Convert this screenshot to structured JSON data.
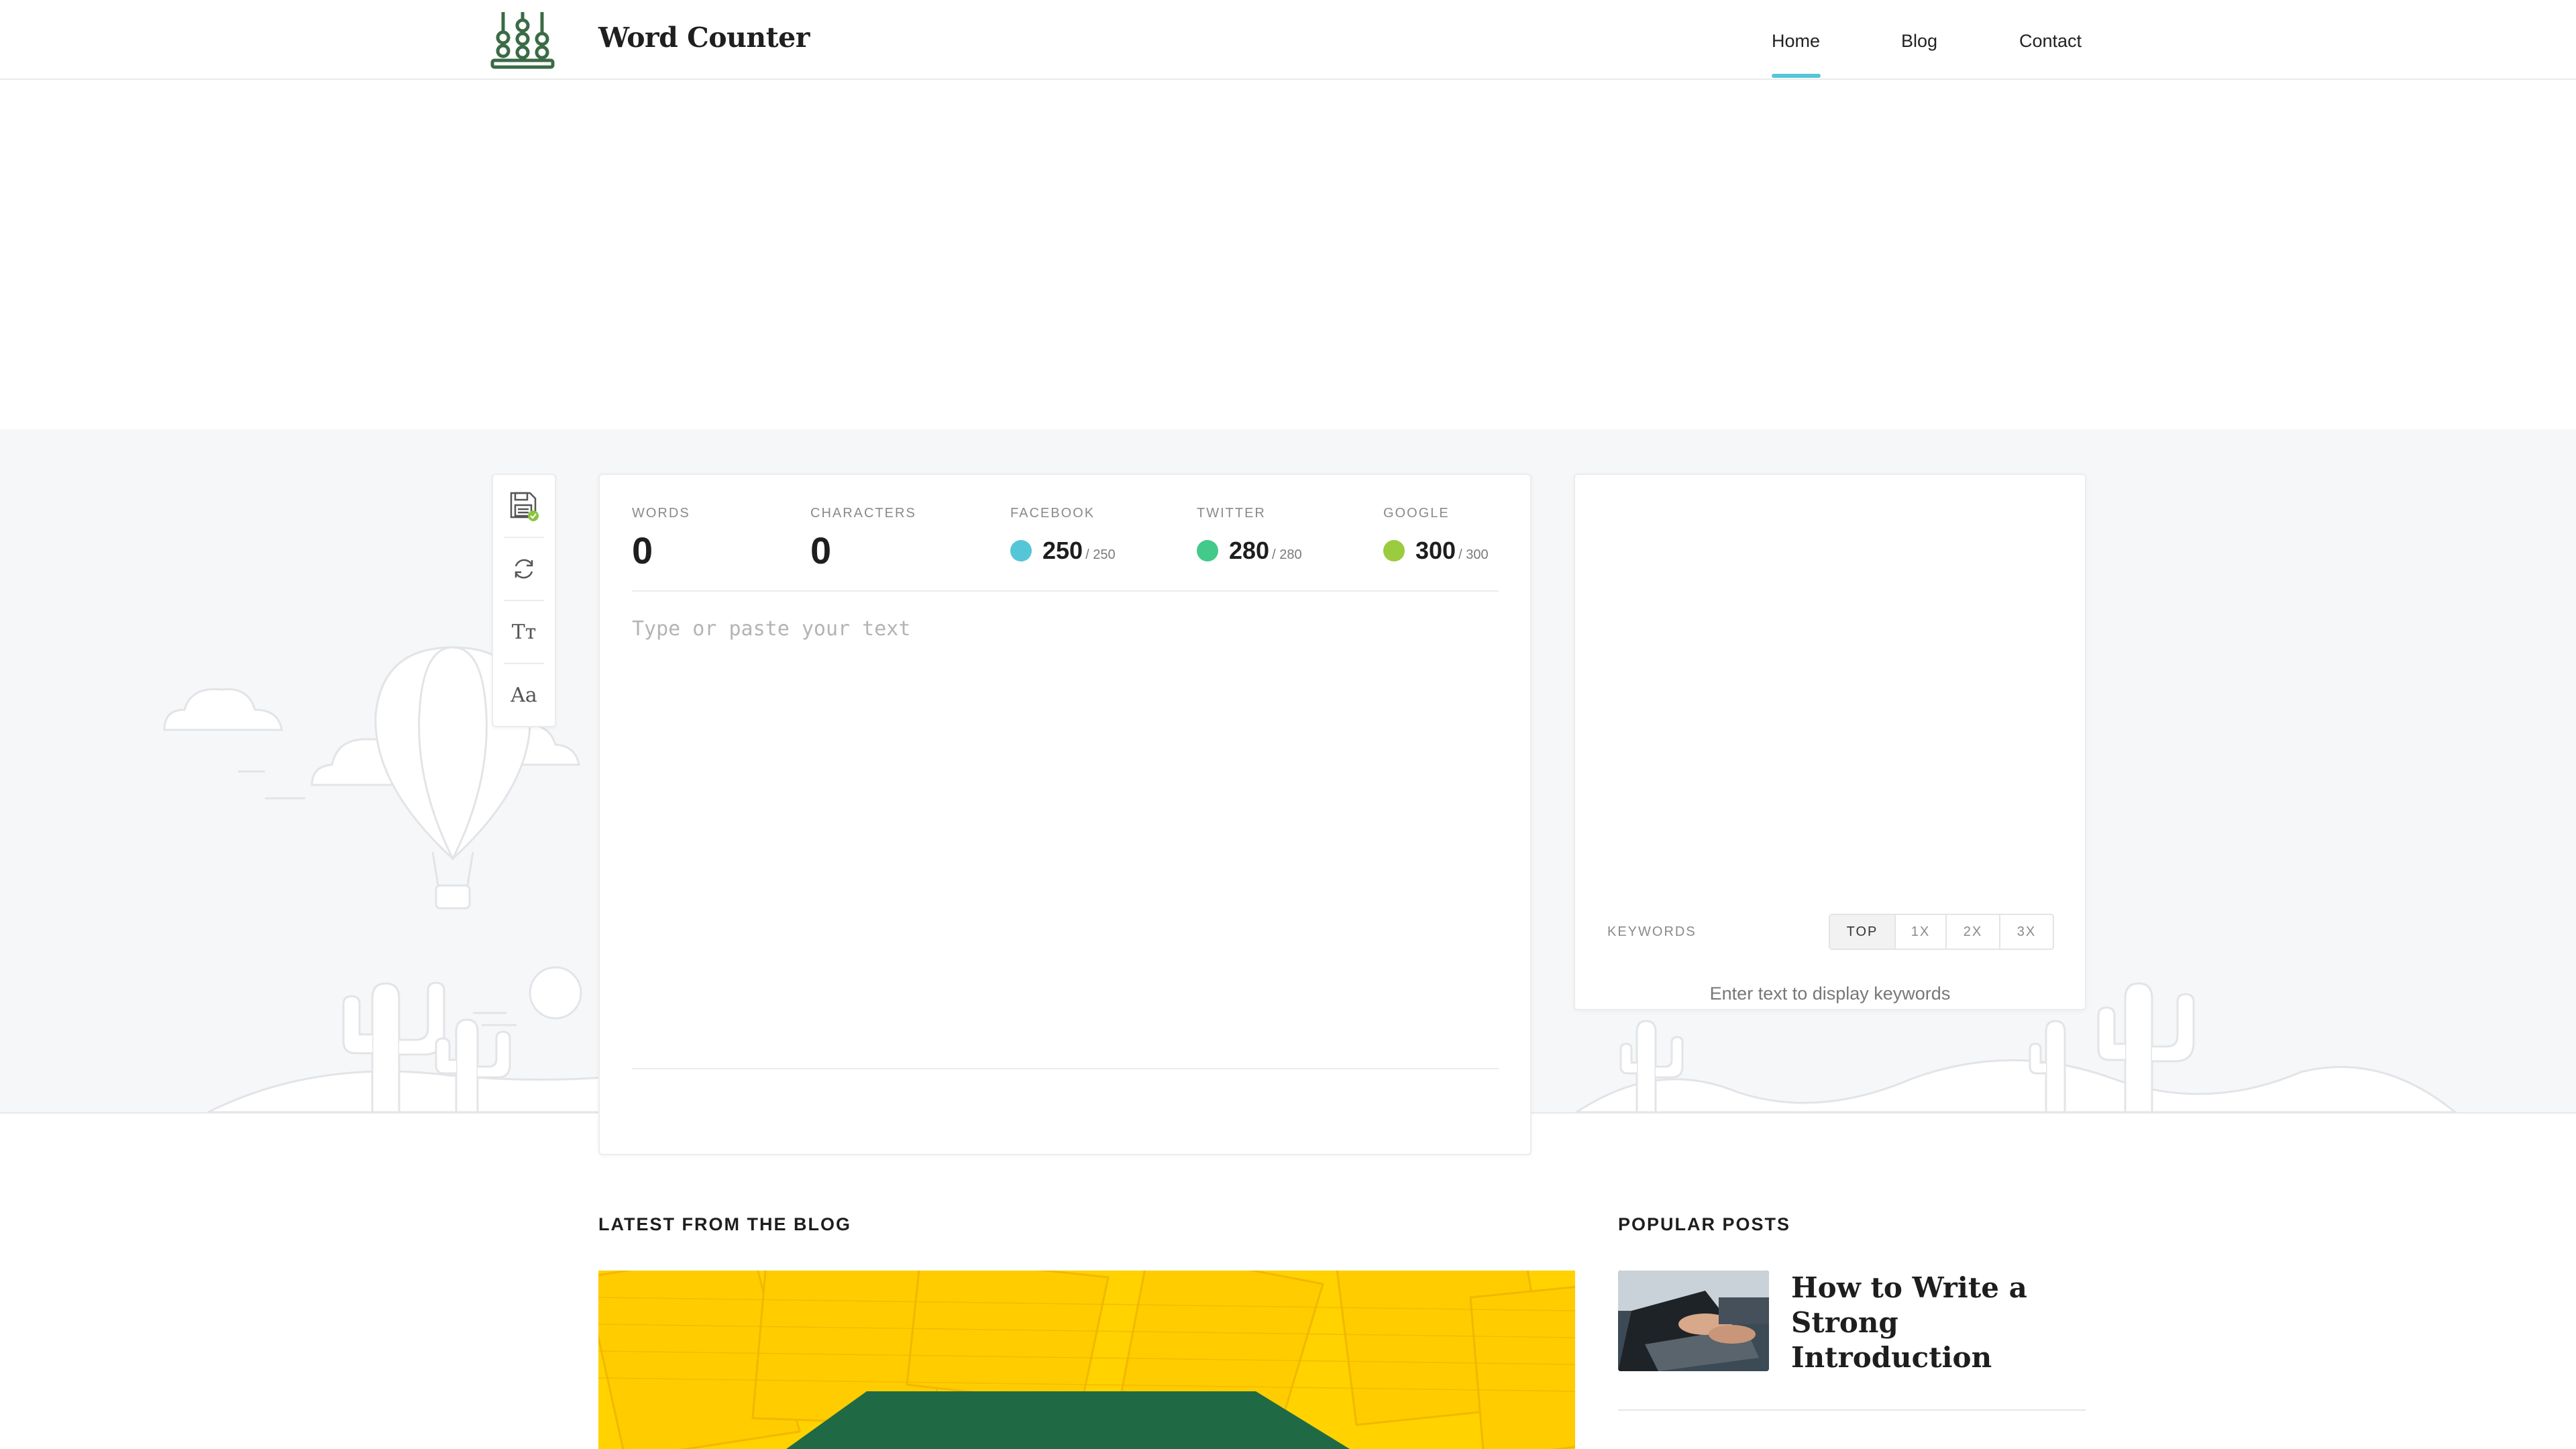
{
  "brand": {
    "name": "Word Counter",
    "logo_icon": "abacus-icon",
    "accent": "#3a6b45"
  },
  "nav": {
    "items": [
      {
        "label": "Home",
        "active": true
      },
      {
        "label": "Blog",
        "active": false
      },
      {
        "label": "Contact",
        "active": false
      }
    ],
    "active_color": "#55c6d8"
  },
  "toolbar": {
    "tools": [
      {
        "name": "save-icon"
      },
      {
        "name": "refresh-icon"
      },
      {
        "name": "text-size-icon",
        "glyph": "Tт"
      },
      {
        "name": "font-case-icon",
        "glyph": "Aa"
      }
    ]
  },
  "stats": {
    "words": {
      "label": "WORDS",
      "value": "0"
    },
    "characters": {
      "label": "CHARACTERS",
      "value": "0"
    },
    "facebook": {
      "label": "FACEBOOK",
      "value": "250",
      "limit": "/ 250",
      "color": "#55c6d8"
    },
    "twitter": {
      "label": "TWITTER",
      "value": "280",
      "limit": "/ 280",
      "color": "#43c98a"
    },
    "google": {
      "label": "GOOGLE",
      "value": "300",
      "limit": "/ 300",
      "color": "#9bcb3f"
    }
  },
  "editor": {
    "placeholder": "Type or paste your text",
    "value": ""
  },
  "keywords": {
    "label": "KEYWORDS",
    "tabs": [
      {
        "label": "TOP",
        "active": true
      },
      {
        "label": "1X",
        "active": false
      },
      {
        "label": "2X",
        "active": false
      },
      {
        "label": "3X",
        "active": false
      }
    ],
    "empty_text": "Enter text to display keywords"
  },
  "blog": {
    "latest_title": "LATEST FROM THE BLOG",
    "popular_title": "POPULAR POSTS",
    "popular_posts": [
      {
        "title": "How to Write a Strong Introduction"
      }
    ]
  }
}
